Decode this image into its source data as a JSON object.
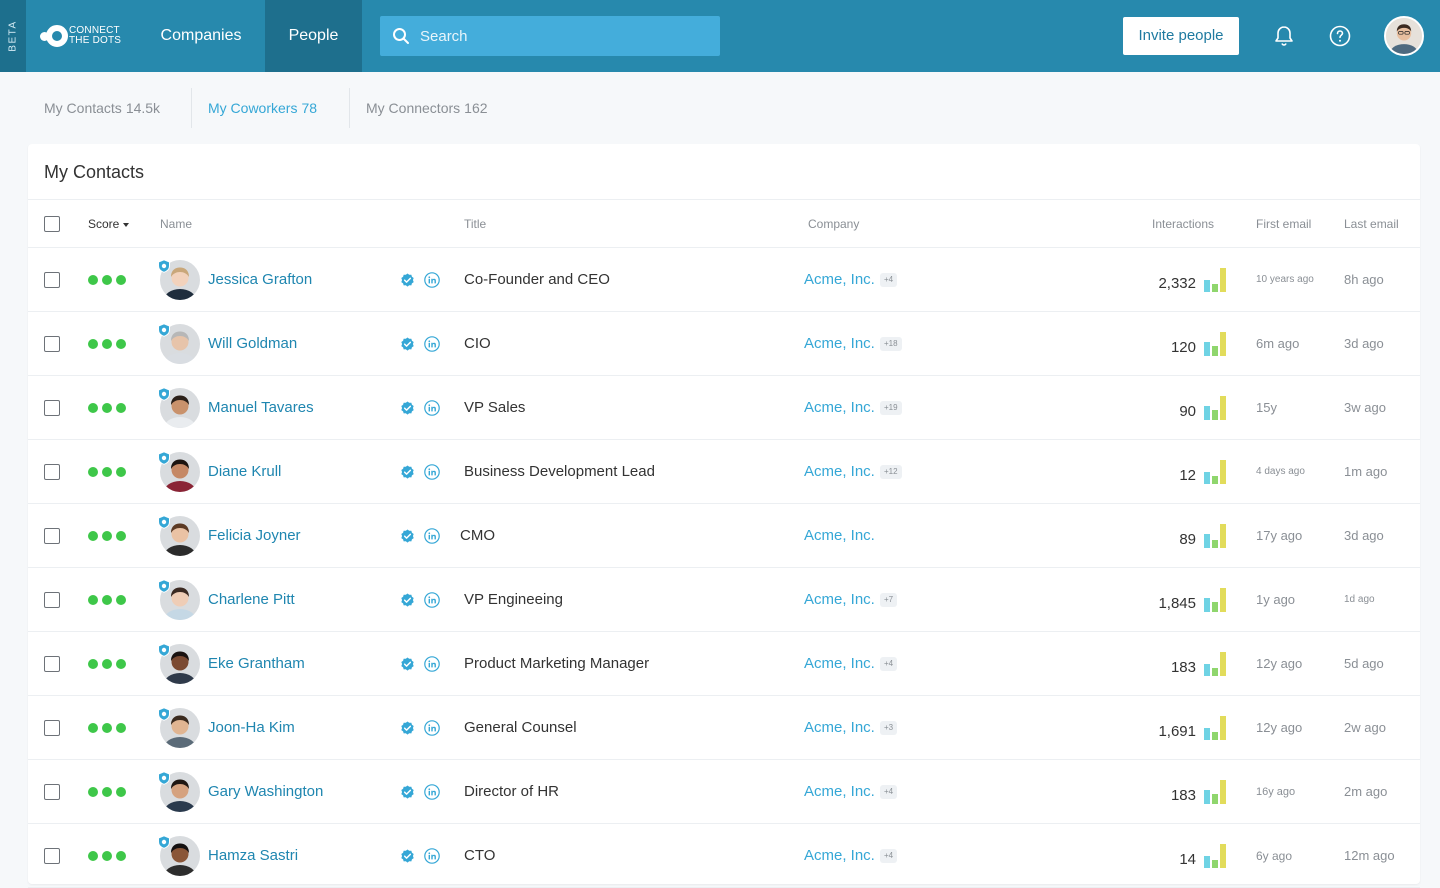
{
  "app": {
    "beta_label": "BETA",
    "logo_line1": "CONNECT",
    "logo_line2": "THE DOTS",
    "nav": {
      "companies": "Companies",
      "people": "People"
    },
    "search_placeholder": "Search",
    "invite_label": "Invite people"
  },
  "subtabs": [
    {
      "label": "My Contacts",
      "count": "14.5k",
      "active": false
    },
    {
      "label": "My Coworkers",
      "count": "78",
      "active": true
    },
    {
      "label": "My Connectors",
      "count": "162",
      "active": false
    }
  ],
  "card": {
    "title": "My Contacts",
    "columns": {
      "score": "Score",
      "name": "Name",
      "title": "Title",
      "company": "Company",
      "interactions": "Interactions",
      "first_email": "First email",
      "last_email": "Last email"
    }
  },
  "colors": {
    "primary": "#2789ad",
    "link": "#35a7d6",
    "score_green": "#3ec749",
    "bar_cyan": "#6fd3e4",
    "bar_green": "#8fd66d",
    "bar_yellow": "#e2dc5b"
  },
  "rows": [
    {
      "name": "Jessica Grafton",
      "title": "Co-Founder and CEO",
      "company": "Acme, Inc.",
      "extra": "+4",
      "interactions": "2,332",
      "first_email": "10 years ago",
      "last_email": "8h ago",
      "skin": "#f2d2bc",
      "hair": "#c9a77a",
      "shirt": "#1f2d3d"
    },
    {
      "name": "Will Goldman",
      "title": "CIO",
      "company": "Acme, Inc.",
      "extra": "+18",
      "interactions": "120",
      "first_email": "6m ago",
      "last_email": "3d ago",
      "skin": "#e7c4aa",
      "hair": "#b7b7b7",
      "shirt": "#d9dde2"
    },
    {
      "name": "Manuel Tavares",
      "title": "VP Sales",
      "company": "Acme, Inc.",
      "extra": "+19",
      "interactions": "90",
      "first_email": "15y",
      "last_email": "3w ago",
      "skin": "#c9926c",
      "hair": "#2b2019",
      "shirt": "#e9ecef"
    },
    {
      "name": "Diane Krull",
      "title": "Business Development Lead",
      "company": "Acme, Inc.",
      "extra": "+12",
      "interactions": "12",
      "first_email": "4 days ago",
      "last_email": "1m ago",
      "skin": "#c58865",
      "hair": "#1d1410",
      "shirt": "#8a2435"
    },
    {
      "name": "Felicia Joyner",
      "title": "CMO",
      "company": "Acme, Inc.",
      "extra": "",
      "interactions": "89",
      "first_email": "17y ago",
      "last_email": "3d ago",
      "skin": "#eac2a4",
      "hair": "#5c3a24",
      "shirt": "#2b2b2b"
    },
    {
      "name": "Charlene Pitt",
      "title": "VP Engineeing",
      "company": "Acme, Inc.",
      "extra": "+7",
      "interactions": "1,845",
      "first_email": "1y ago",
      "last_email": "1d ago",
      "skin": "#efcdb6",
      "hair": "#3b2a22",
      "shirt": "#c5d8e5"
    },
    {
      "name": "Eke Grantham",
      "title": "Product Marketing Manager",
      "company": "Acme, Inc.",
      "extra": "+4",
      "interactions": "183",
      "first_email": "12y ago",
      "last_email": "5d ago",
      "skin": "#7b4a32",
      "hair": "#1a1210",
      "shirt": "#2f3a4a"
    },
    {
      "name": "Joon-Ha Kim",
      "title": "General Counsel",
      "company": "Acme, Inc.",
      "extra": "+3",
      "interactions": "1,691",
      "first_email": "12y ago",
      "last_email": "2w ago",
      "skin": "#e0b592",
      "hair": "#3a2a1e",
      "shirt": "#5b6b78"
    },
    {
      "name": "Gary Washington",
      "title": "Director of HR",
      "company": "Acme, Inc.",
      "extra": "+4",
      "interactions": "183",
      "first_email": "16y ago",
      "last_email": "2m ago",
      "skin": "#d5a27f",
      "hair": "#1f1712",
      "shirt": "#2a3a4d"
    },
    {
      "name": "Hamza Sastri",
      "title": "CTO",
      "company": "Acme, Inc.",
      "extra": "+4",
      "interactions": "14",
      "first_email": "6y ago",
      "last_email": "12m ago",
      "skin": "#8a5638",
      "hair": "#141010",
      "shirt": "#2d2d2d"
    }
  ]
}
